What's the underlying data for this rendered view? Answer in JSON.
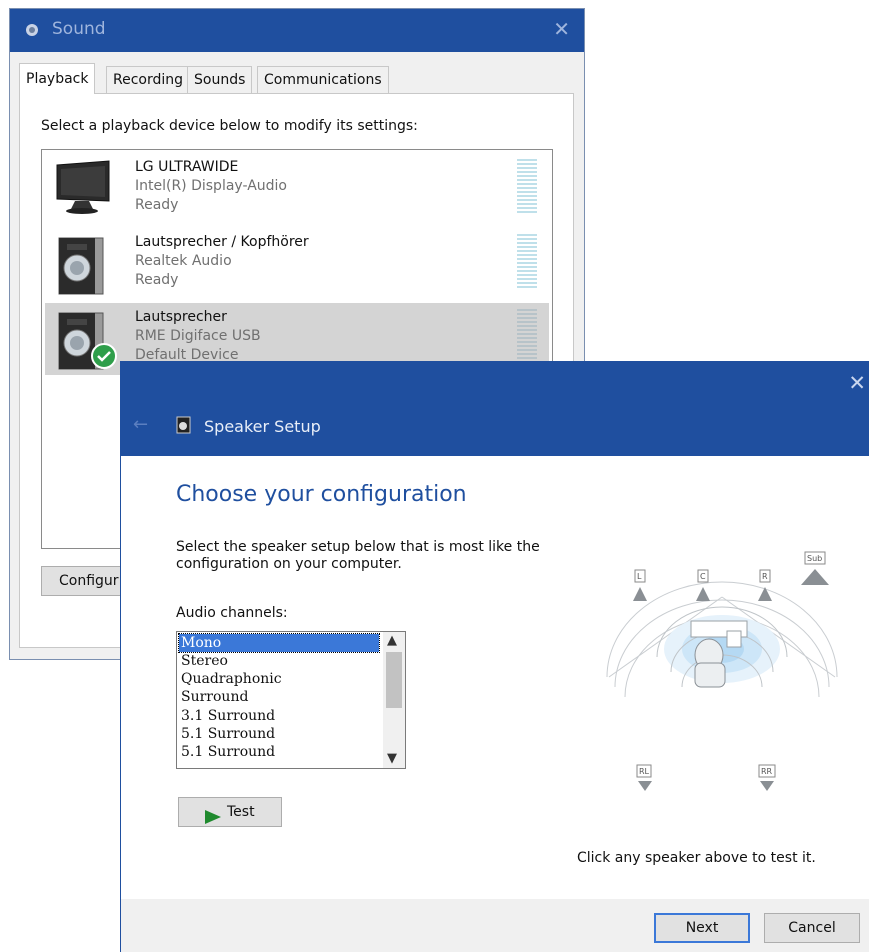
{
  "sound_window": {
    "title": "Sound",
    "tabs": [
      "Playback",
      "Recording",
      "Sounds",
      "Communications"
    ],
    "instruction": "Select a playback device below to modify its settings:",
    "devices": [
      {
        "name": "LG ULTRAWIDE",
        "driver": "Intel(R) Display-Audio",
        "status": "Ready",
        "icon": "monitor-icon"
      },
      {
        "name": "Lautsprecher / Kopfhörer",
        "driver": "Realtek Audio",
        "status": "Ready",
        "icon": "speaker-icon"
      },
      {
        "name": "Lautsprecher",
        "driver": "RME Digiface USB",
        "status": "Default Device",
        "icon": "speaker-icon",
        "default": true
      }
    ],
    "configure_label": "Configur"
  },
  "setup_window": {
    "title": "Speaker Setup",
    "heading": "Choose your configuration",
    "description": "Select the speaker setup below that is most like the configuration on your computer.",
    "channels_label": "Audio channels:",
    "channels": [
      "Mono",
      "Stereo",
      "Quadraphonic",
      "Surround",
      "3.1 Surround",
      "5.1 Surround",
      "5.1 Surround"
    ],
    "selected_channel": "Mono",
    "test_label": "Test",
    "speaker_hint": "Click any speaker above to test it.",
    "speakers": {
      "left": "L",
      "center": "C",
      "right": "R",
      "sub": "Sub",
      "rear_left": "RL",
      "rear_right": "RR"
    },
    "next_label": "Next",
    "cancel_label": "Cancel"
  },
  "colors": {
    "titlebar": "#1f4f9f",
    "accent": "#3b78d8",
    "heading": "#1f4f9f",
    "default_check": "#2e9e4a"
  }
}
